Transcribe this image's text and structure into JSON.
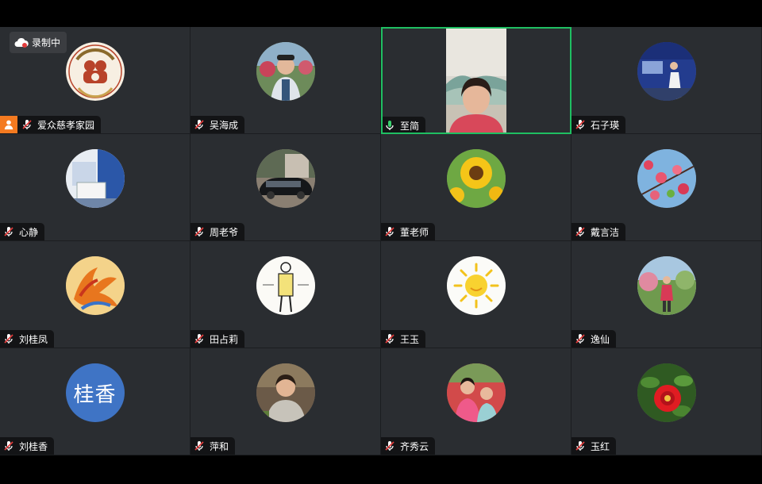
{
  "recording": {
    "label": "录制中",
    "icon": "cloud-recording-icon"
  },
  "participants": [
    {
      "name": "爱众慈孝家园",
      "mic": "muted",
      "avatar": "logo-avatar",
      "host": true
    },
    {
      "name": "吴海成",
      "mic": "muted",
      "avatar": "photo-avatar"
    },
    {
      "name": "至简",
      "mic": "active",
      "video": true,
      "speaking": true
    },
    {
      "name": "石子瑛",
      "mic": "muted",
      "avatar": "photo-avatar"
    },
    {
      "name": "心静",
      "mic": "muted",
      "avatar": "photo-avatar"
    },
    {
      "name": "周老爷",
      "mic": "muted",
      "avatar": "photo-avatar"
    },
    {
      "name": "董老师",
      "mic": "muted",
      "avatar": "sunflower-avatar"
    },
    {
      "name": "戴言洁",
      "mic": "muted",
      "avatar": "blossom-avatar"
    },
    {
      "name": "刘桂凤",
      "mic": "muted",
      "avatar": "phoenix-avatar"
    },
    {
      "name": "田占莉",
      "mic": "muted",
      "avatar": "drawing-avatar"
    },
    {
      "name": "王玉",
      "mic": "muted",
      "avatar": "sun-drawing-avatar"
    },
    {
      "name": "逸仙",
      "mic": "muted",
      "avatar": "photo-avatar"
    },
    {
      "name": "刘桂香",
      "mic": "muted",
      "avatar_text": "桂香"
    },
    {
      "name": "萍和",
      "mic": "muted",
      "avatar": "photo-avatar"
    },
    {
      "name": "齐秀云",
      "mic": "muted",
      "avatar": "photo-avatar"
    },
    {
      "name": "玉红",
      "mic": "muted",
      "avatar": "rose-avatar"
    }
  ],
  "colors": {
    "active_border": "#1fbf62",
    "host_badge": "#f47a20",
    "mic_muted": "#e23c3c",
    "mic_active": "#3bd16f"
  }
}
